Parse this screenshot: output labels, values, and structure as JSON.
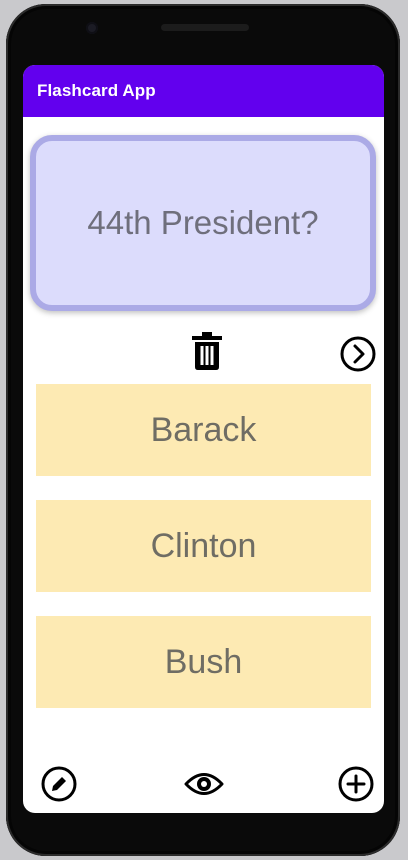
{
  "app": {
    "title": "Flashcard App"
  },
  "card": {
    "question": "44th President?"
  },
  "answers": [
    {
      "label": "Barack"
    },
    {
      "label": "Clinton"
    },
    {
      "label": "Bush"
    }
  ],
  "icons": {
    "delete": "trash-icon",
    "next": "chevron-right-circle-icon",
    "edit": "pencil-circle-icon",
    "toggle_visibility": "eye-icon",
    "add": "plus-circle-icon"
  },
  "colors": {
    "app_bar": "#6200ee",
    "question_card_fill": "#dcdcfc",
    "question_card_border": "#abaae6",
    "answer_fill": "#fdeab3"
  }
}
